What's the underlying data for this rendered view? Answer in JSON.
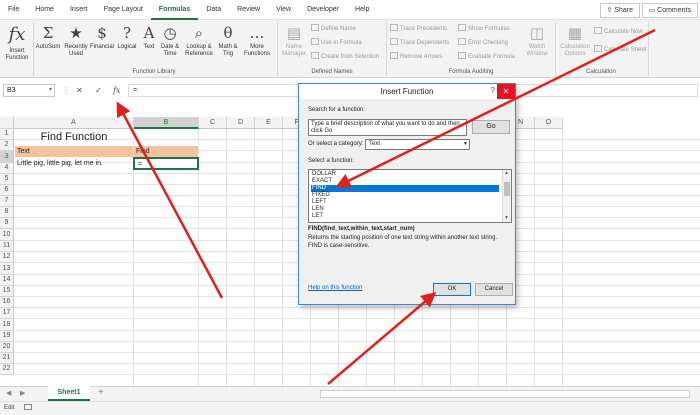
{
  "menu": {
    "items": [
      "File",
      "Home",
      "Insert",
      "Page Layout",
      "Formulas",
      "Data",
      "Review",
      "View",
      "Developer",
      "Help"
    ],
    "active": "Formulas",
    "share": "Share",
    "comments": "Comments"
  },
  "ribbon": {
    "insert_function": "Insert Function",
    "function_library": {
      "buttons": [
        {
          "label": "AutoSum",
          "icon": "Σ"
        },
        {
          "label": "Recently Used",
          "icon": "★"
        },
        {
          "label": "Financial",
          "icon": "$"
        },
        {
          "label": "Logical",
          "icon": "?"
        },
        {
          "label": "Text",
          "icon": "A"
        },
        {
          "label": "Date & Time",
          "icon": "◷"
        },
        {
          "label": "Lookup & Reference",
          "icon": "⌕"
        },
        {
          "label": "Math & Trig",
          "icon": "θ"
        },
        {
          "label": "More Functions",
          "icon": "…"
        }
      ],
      "group_label": "Function Library"
    },
    "defined_names": {
      "name_manager": "Name Manager",
      "define_name": "Define Name",
      "use_in_formula": "Use in Formula",
      "create_from_selection": "Create from Selection",
      "group_label": "Defined Names"
    },
    "formula_auditing": {
      "trace_precedents": "Trace Precedents",
      "trace_dependents": "Trace Dependents",
      "remove_arrows": "Remove Arrows",
      "show_formulas": "Show Formulas",
      "error_checking": "Error Checking",
      "evaluate_formula": "Evaluate Formula",
      "watch_window": "Watch Window",
      "group_label": "Formula Auditing"
    },
    "calculation": {
      "calculation_options": "Calculation Options",
      "calculate_now": "Calculate Now",
      "calculate_sheet": "Calculate Sheet",
      "group_label": "Calculation"
    }
  },
  "formula_bar": {
    "name_box": "B3",
    "content": "="
  },
  "sheet": {
    "columns": [
      "A",
      "B",
      "C",
      "D",
      "E",
      "F",
      "G",
      "H",
      "I",
      "J",
      "K",
      "L",
      "M",
      "N",
      "O"
    ],
    "rows": [
      "1",
      "2",
      "3",
      "4",
      "5",
      "6",
      "7",
      "8",
      "9",
      "10",
      "11",
      "12",
      "13",
      "14",
      "15",
      "16",
      "17",
      "18",
      "19",
      "20",
      "21",
      "22"
    ],
    "title": "Find Function",
    "a2": "Text",
    "b2": "Find",
    "a3": "Little pig, little pig, let me in.",
    "b3": "=",
    "header_fill": "#f4c29c"
  },
  "tabs": {
    "sheet1": "Sheet1",
    "add": "+",
    "prev": "◀",
    "next": "▶"
  },
  "status": {
    "mode": "Edit"
  },
  "dialog": {
    "title": "Insert Function",
    "help": "?",
    "close": "✕",
    "search_label": "Search for a function:",
    "search_value": "Type a brief description of what you want to do and then click Go",
    "go": "Go",
    "category_label": "Or select a category:",
    "category_value": "Text",
    "function_label": "Select a function:",
    "functions": [
      "DOLLAR",
      "EXACT",
      "FIND",
      "FIXED",
      "LEFT",
      "LEN",
      "LET"
    ],
    "selected_function": "FIND",
    "signature": "FIND(find_text,within_text,start_num)",
    "description": "Returns the starting position of one text string within another text string. FIND is case-sensitive.",
    "help_link": "Help on this function",
    "ok": "OK",
    "cancel": "Cancel"
  },
  "colors": {
    "accent": "#217346",
    "arrow": "#e0201a",
    "selection": "#0078d7"
  }
}
